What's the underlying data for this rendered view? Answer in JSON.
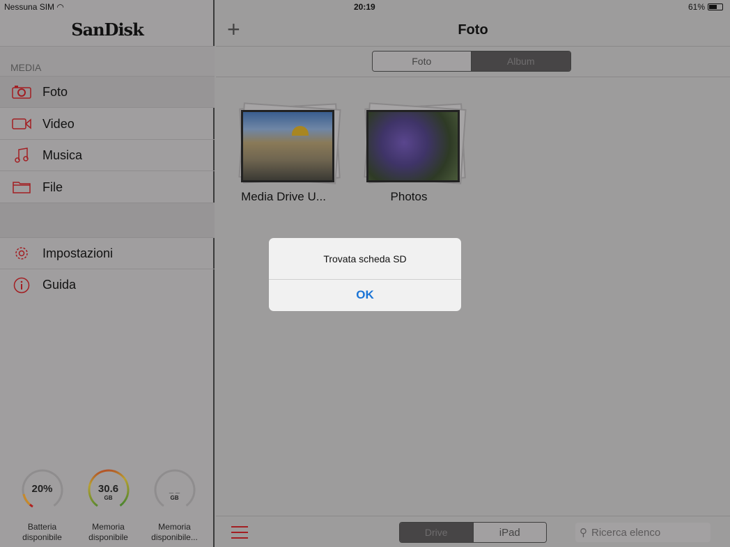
{
  "status": {
    "carrier": "Nessuna SIM",
    "time": "20:19",
    "battery": "61%",
    "battery_level": 0.61
  },
  "sidebar": {
    "logo": "SanDisk",
    "section": "MEDIA",
    "items": [
      {
        "label": "Foto",
        "icon": "camera-icon"
      },
      {
        "label": "Video",
        "icon": "video-icon"
      },
      {
        "label": "Musica",
        "icon": "music-icon"
      },
      {
        "label": "File",
        "icon": "folder-icon"
      }
    ],
    "settings": [
      {
        "label": "Impostazioni",
        "icon": "gear-icon"
      },
      {
        "label": "Guida",
        "icon": "info-icon"
      }
    ],
    "gauges": [
      {
        "value": "20%",
        "unit": "",
        "label1": "Batteria",
        "label2": "disponibile",
        "fraction": 0.2
      },
      {
        "value": "30.6",
        "unit": "GB",
        "label1": "Memoria",
        "label2": "disponibile",
        "fraction": 1.0
      },
      {
        "value": "_ _",
        "unit": "GB",
        "label1": "Memoria",
        "label2": "disponibile...",
        "fraction": 0
      }
    ]
  },
  "header": {
    "title": "Foto",
    "add": "+"
  },
  "segment": {
    "options": [
      "Foto",
      "Album"
    ],
    "selected": "Album"
  },
  "albums": [
    {
      "name": "Media Drive U..."
    },
    {
      "name": "Photos"
    }
  ],
  "dialog": {
    "message": "Trovata scheda SD",
    "button": "OK"
  },
  "bottom": {
    "source": [
      "Drive",
      "iPad"
    ],
    "selected": "Drive",
    "search_placeholder": "Ricerca elenco"
  },
  "colors": {
    "accent": "#a31e22",
    "link": "#1a74d6"
  }
}
